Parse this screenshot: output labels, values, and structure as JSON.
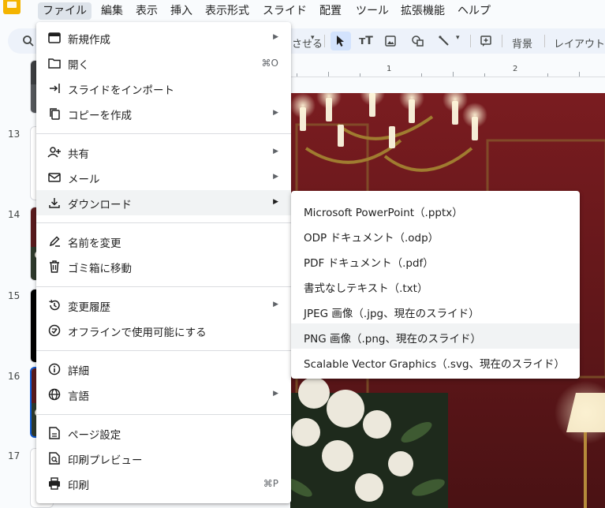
{
  "menubar": {
    "items": [
      {
        "label": "ファイル"
      },
      {
        "label": "編集"
      },
      {
        "label": "表示"
      },
      {
        "label": "挿入"
      },
      {
        "label": "表示形式"
      },
      {
        "label": "スライド"
      },
      {
        "label": "配置"
      },
      {
        "label": "ツール"
      },
      {
        "label": "拡張機能"
      },
      {
        "label": "ヘルプ"
      }
    ]
  },
  "toolbar": {
    "partial_label": "させる",
    "background_label": "背景",
    "layout_label": "レイアウト"
  },
  "ruler": {
    "marks": [
      "1",
      "2"
    ]
  },
  "filmstrip": {
    "slide_numbers": [
      "13",
      "14",
      "15",
      "16",
      "17"
    ]
  },
  "file_menu": {
    "items": [
      {
        "label": "新規作成",
        "icon": "new-slides-icon",
        "submenu": true
      },
      {
        "label": "開く",
        "icon": "folder-icon",
        "shortcut": "⌘O"
      },
      {
        "label": "スライドをインポート",
        "icon": "import-icon"
      },
      {
        "label": "コピーを作成",
        "icon": "copy-icon",
        "submenu": true
      },
      {
        "label": "共有",
        "icon": "person-add-icon",
        "submenu": true
      },
      {
        "label": "メール",
        "icon": "mail-icon",
        "submenu": true
      },
      {
        "label": "ダウンロード",
        "icon": "download-icon",
        "submenu": true
      },
      {
        "label": "名前を変更",
        "icon": "rename-icon"
      },
      {
        "label": "ゴミ箱に移動",
        "icon": "trash-icon"
      },
      {
        "label": "変更履歴",
        "icon": "history-icon",
        "submenu": true
      },
      {
        "label": "オフラインで使用可能にする",
        "icon": "offline-icon"
      },
      {
        "label": "詳細",
        "icon": "info-icon"
      },
      {
        "label": "言語",
        "icon": "globe-icon",
        "submenu": true
      },
      {
        "label": "ページ設定",
        "icon": "page-setup-icon"
      },
      {
        "label": "印刷プレビュー",
        "icon": "print-preview-icon"
      },
      {
        "label": "印刷",
        "icon": "print-icon",
        "shortcut": "⌘P"
      }
    ]
  },
  "download_submenu": {
    "items": [
      {
        "label": "Microsoft PowerPoint（.pptx）"
      },
      {
        "label": "ODP ドキュメント（.odp）"
      },
      {
        "label": "PDF ドキュメント（.pdf）"
      },
      {
        "label": "書式なしテキスト（.txt）"
      },
      {
        "label": "JPEG 画像（.jpg、現在のスライド）"
      },
      {
        "label": "PNG 画像（.png、現在のスライド）"
      },
      {
        "label": "Scalable Vector Graphics（.svg、現在のスライド）"
      }
    ]
  },
  "colors": {
    "accent": "#0b57d0",
    "menu_active": "#dde3ea",
    "hover": "#f1f3f4",
    "slides_yellow": "#f4b400"
  }
}
